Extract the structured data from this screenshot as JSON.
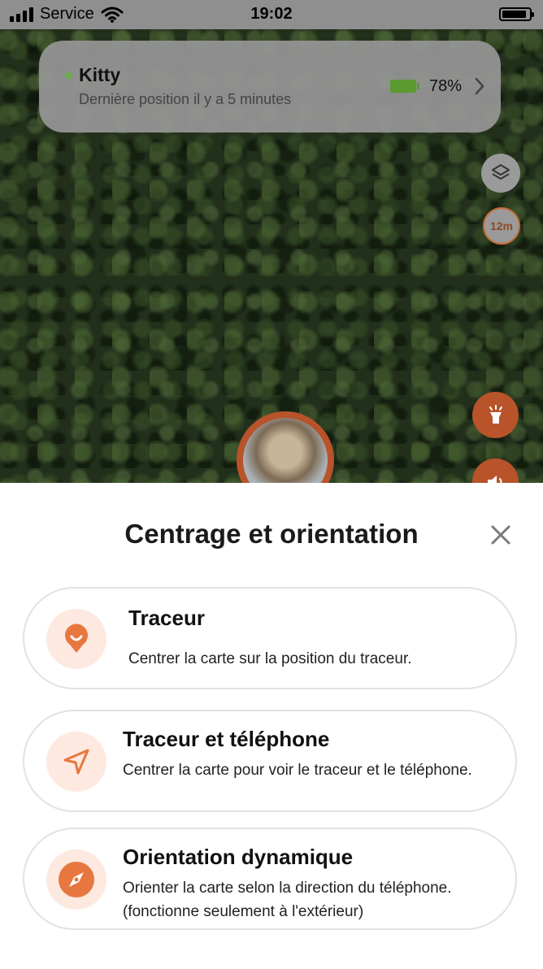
{
  "status_bar": {
    "carrier": "Service",
    "time": "19:02",
    "battery_level": 0.9
  },
  "tracker_card": {
    "name": "Kitty",
    "last_position": "Dernière position il y a 5 minutes",
    "battery_percent": "78%",
    "status_color": "#6bb140"
  },
  "map_controls": {
    "time_badge": "12m"
  },
  "sheet": {
    "title": "Centrage et orientation",
    "options": [
      {
        "title": "Traceur",
        "description": "Centrer la carte sur la position du traceur.",
        "icon": "tracker-pin-icon"
      },
      {
        "title": "Traceur et téléphone",
        "description": "Centrer la carte pour voir le traceur et le téléphone.",
        "icon": "navigation-arrow-icon"
      },
      {
        "title": "Orientation dynamique",
        "description": "Orienter la carte selon la direction du téléphone. (fonctionne seulement à l'extérieur)",
        "icon": "compass-icon"
      }
    ]
  },
  "colors": {
    "accent": "#e8773f",
    "accent_dark": "#b8532a",
    "icon_bg": "#fde9df",
    "battery_green": "#5b9a2f"
  }
}
